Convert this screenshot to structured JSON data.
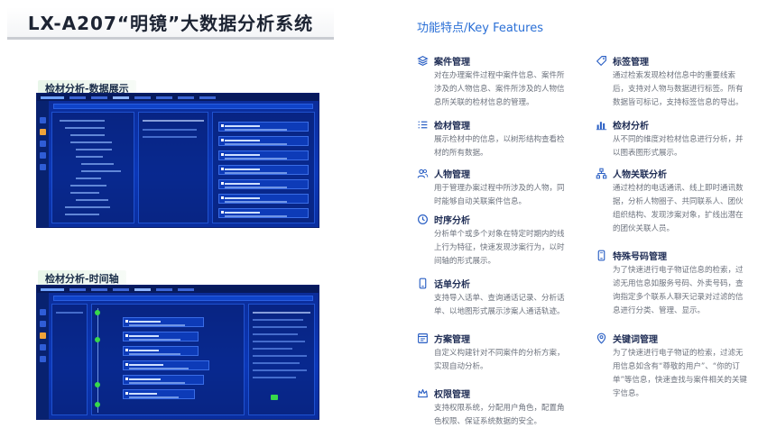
{
  "title": "LX-A207“明镜”大数据分析系统",
  "sections": [
    {
      "tag": "检材分析-数据展示"
    },
    {
      "tag": "检材分析-时间轴"
    }
  ],
  "features_title": "功能特点/Key Features",
  "features_left": [
    {
      "icon": "layers-icon",
      "name": "案件管理",
      "desc": "对在办理案件过程中案件信息、案件所涉及的人物信息、案件所涉及的人物信息所关联的检材信息的管理。"
    },
    {
      "icon": "list-icon",
      "name": "检材管理",
      "desc": "展示检材中的信息，以树形结构查看检材的所有数据。"
    },
    {
      "icon": "people-icon",
      "name": "人物管理",
      "desc": "用于管理办案过程中所涉及的人物，同时能够自动关联案件信息。"
    },
    {
      "icon": "clock-icon",
      "name": "时序分析",
      "desc": "分析单个或多个对象在特定时期内的线上行为特征，快速发现涉案行为，以时间轴的形式展示。"
    },
    {
      "icon": "phone-icon",
      "name": "话单分析",
      "desc": "支持导入话单、查询通话记录、分析话单、以地图形式展示涉案人通话轨迹。"
    },
    {
      "icon": "plan-icon",
      "name": "方案管理",
      "desc": "自定义构建针对不同案件的分析方案，实现自动分析。"
    },
    {
      "icon": "permission-icon",
      "name": "权限管理",
      "desc": "支持权限系统，分配用户角色，配置角色权限、保证系统数据的安全。"
    }
  ],
  "features_right": [
    {
      "icon": "tag-icon",
      "name": "标签管理",
      "desc": "通过检索发现检材信息中的重要线索后，支持对人物与数据进行标签。所有数据皆可标记，支持标签信息的导出。"
    },
    {
      "icon": "bar-chart-icon",
      "name": "检材分析",
      "desc": "从不同的维度对检材信息进行分析，并以图表图形式展示。"
    },
    {
      "icon": "network-icon",
      "name": "人物关联分析",
      "desc": "通过检材的电话通讯、线上即时通讯数据，分析人物圈子、共同联系人、团伙组织结构、发现涉案对象，扩线出潜在的团伙关联人员。"
    },
    {
      "icon": "special-number-icon",
      "name": "特殊号码管理",
      "desc": "为了快速进行电子物证信息的检索，过滤无用信息如服务号码、外卖号码，查询指定多个联系人聊天记录对过滤的信息进行分类、管理、显示。"
    },
    {
      "icon": "keyword-icon",
      "name": "关键词管理",
      "desc": "为了快速进行电子物证的检索，过滤无用信息如含有“尊敬的用户”、“你的订单”等信息，快速查找与案件相关的关键字信息。"
    }
  ],
  "colors": {
    "accent": "#2a6fd6",
    "dashboard_bg": "#0b37b8",
    "tag_bg": "#e8f6e9",
    "status_green": "#37d84b"
  }
}
